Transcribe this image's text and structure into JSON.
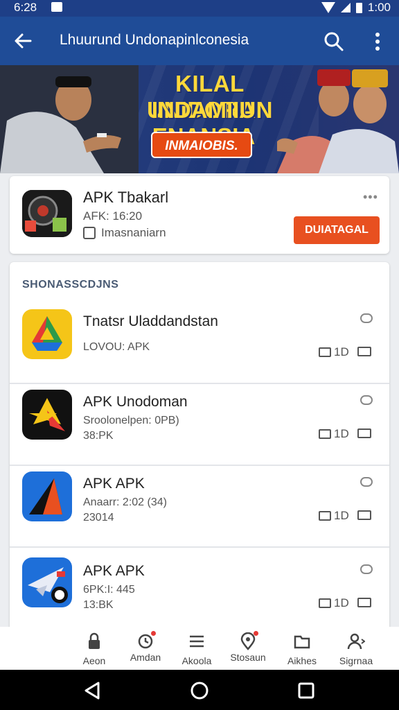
{
  "status_bar": {
    "time": "6:28",
    "right_time": "1:00"
  },
  "app_bar": {
    "title": "Lhuurund Undonapinlconesia"
  },
  "banner": {
    "heading_line1": "KILAL UNIDORAN",
    "heading_line2": "INDAMIIU ENANSIA",
    "cta_label": "INMAIOBIS."
  },
  "featured": {
    "name": "APK Tbakarl",
    "meta": "AFK: 16:20",
    "publisher": "Imasnaniarn",
    "menu_glyph": "•••",
    "install_label": "DUIATAGAL"
  },
  "section": {
    "title": "SHONASSCDJNS"
  },
  "apps": [
    {
      "name": "Tnatsr Uladdandstan",
      "line1": "LOVOU: APK",
      "line2": "",
      "size": "1D"
    },
    {
      "name": "APK Unodoman",
      "line1": "Sroolonelpen: 0PB)",
      "line2": "38:PK",
      "size": "1D"
    },
    {
      "name": "APK APK",
      "line1": "Anaarr: 2:02 (34)",
      "line2": "23014",
      "size": "1D"
    },
    {
      "name": "APK APK",
      "line1": "6PK:I: 445",
      "line2": "13:BK",
      "size": "1D"
    }
  ],
  "bottom_tabs": [
    {
      "label": "Aeon",
      "icon": "lock-icon"
    },
    {
      "label": "Amdan",
      "icon": "update-icon"
    },
    {
      "label": "Akoola",
      "icon": "menu-icon"
    },
    {
      "label": "Stosaun",
      "icon": "location-icon"
    },
    {
      "label": "Aikhes",
      "icon": "folder-icon"
    },
    {
      "label": "Sigrnaa",
      "icon": "profile-icon"
    }
  ],
  "colors": {
    "app_bar": "#1f4c97",
    "accent": "#e85020",
    "banner_text": "#ffd83a"
  }
}
